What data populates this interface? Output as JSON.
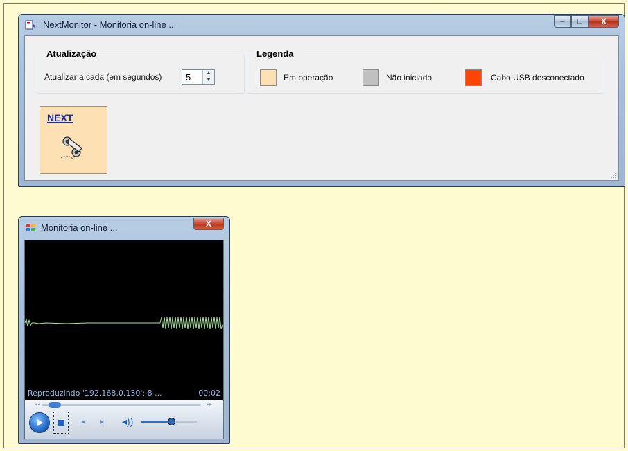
{
  "main_window": {
    "title": "NextMonitor - Monitoria on-line ...",
    "controls": {
      "minimize": "–",
      "maximize": "□",
      "close": "X"
    },
    "update_group": {
      "title": "Atualização",
      "label": "Atualizar a cada (em segundos)",
      "interval_value": "5"
    },
    "legend_group": {
      "title": "Legenda",
      "items": [
        {
          "label": "Em operação",
          "color": "#fde1b4"
        },
        {
          "label": "Não iniciado",
          "color": "#c0c0c0"
        },
        {
          "label": "Cabo USB desconectado",
          "color": "#ff4500"
        }
      ]
    },
    "device_tile": {
      "link": "NEXT",
      "icon": "handset-device-icon"
    }
  },
  "player_window": {
    "title": "Monitoria on-line ...",
    "controls": {
      "close": "X"
    },
    "status_text": "Reproduzindo '192.168.0.130': 8 ...",
    "time": "00:02",
    "seek_left_arrows": "◂◂",
    "seek_right_arrows": "▸▸",
    "waveform_color": "#a8e6a0"
  }
}
